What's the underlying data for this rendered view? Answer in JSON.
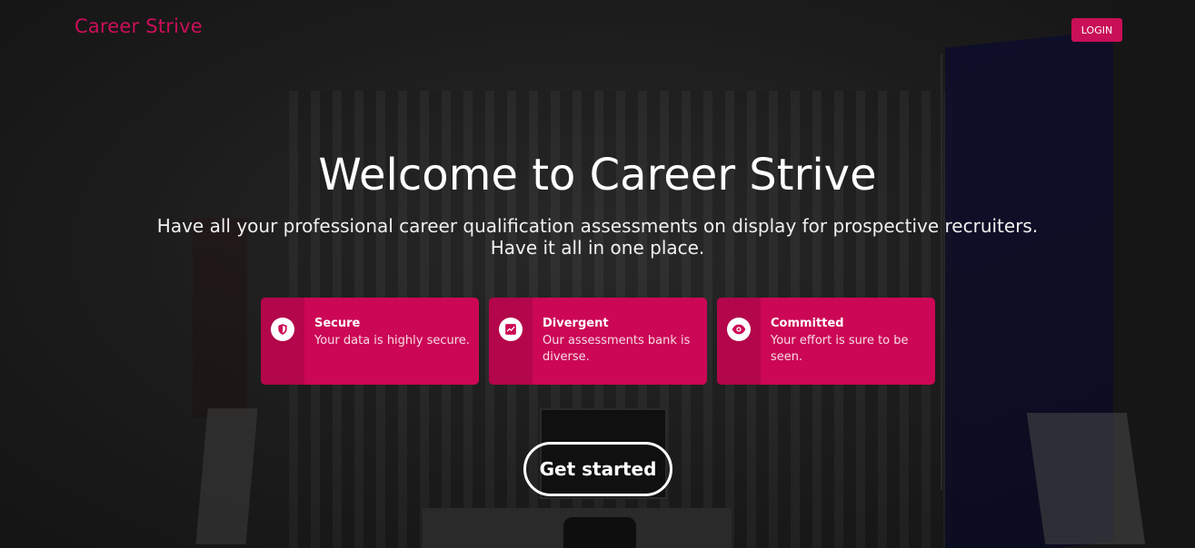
{
  "header": {
    "logo": "Career Strive",
    "login_label": "LOGIN"
  },
  "hero": {
    "title": "Welcome to Career Strive",
    "subtitle_line1": "Have all your professional career qualification assessments on display for prospective recruiters.",
    "subtitle_line2": "Have it all in one place."
  },
  "features": [
    {
      "title": "Secure",
      "text": "Your data is highly secure.",
      "icon": "shield-icon"
    },
    {
      "title": "Divergent",
      "text": "Our assessments bank is diverse.",
      "icon": "chart-icon"
    },
    {
      "title": "Committed",
      "text": "Your effort is sure to be seen.",
      "icon": "eye-icon"
    }
  ],
  "cta": {
    "label": "Get started"
  },
  "colors": {
    "accent": "#cc0755",
    "accent_dark": "#b3064b",
    "logo": "#cc0e5a"
  }
}
